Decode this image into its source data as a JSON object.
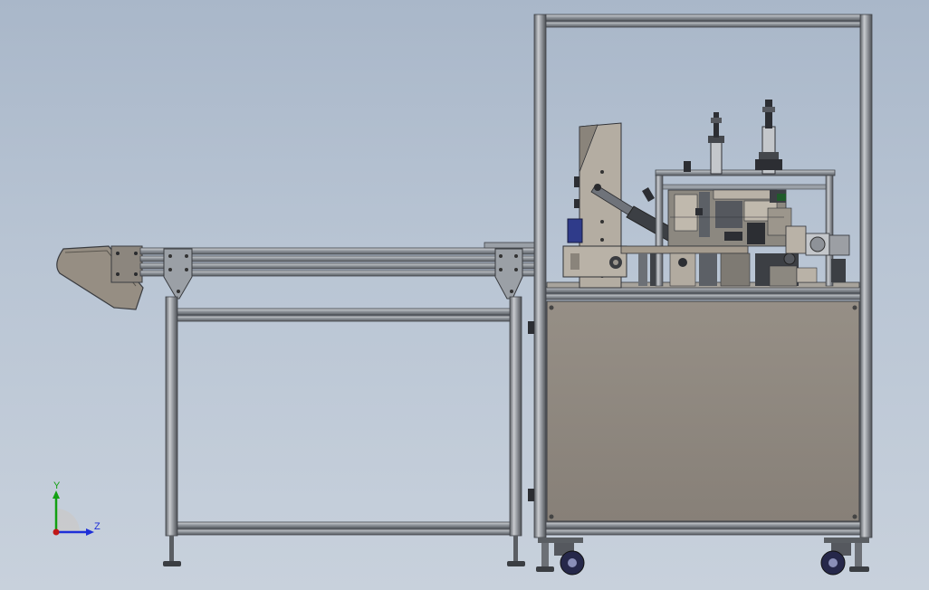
{
  "viewport": {
    "background_top": "#a9b7c9",
    "background_bottom": "#c8d1dc"
  },
  "model": {
    "description_icon": "machine-assembly-icon",
    "colors": {
      "frame": "#7b7f86",
      "frame_dark": "#45484d",
      "panel": "#8e8a84",
      "plate": "#b9b2a7",
      "blue_part": "#2f3b8a",
      "dark": "#2c2e33"
    }
  },
  "triad": {
    "y_label": "Y",
    "z_label": "Z",
    "y_color": "#12a012",
    "z_color": "#1e2fd8",
    "x_color": "#c01818"
  }
}
